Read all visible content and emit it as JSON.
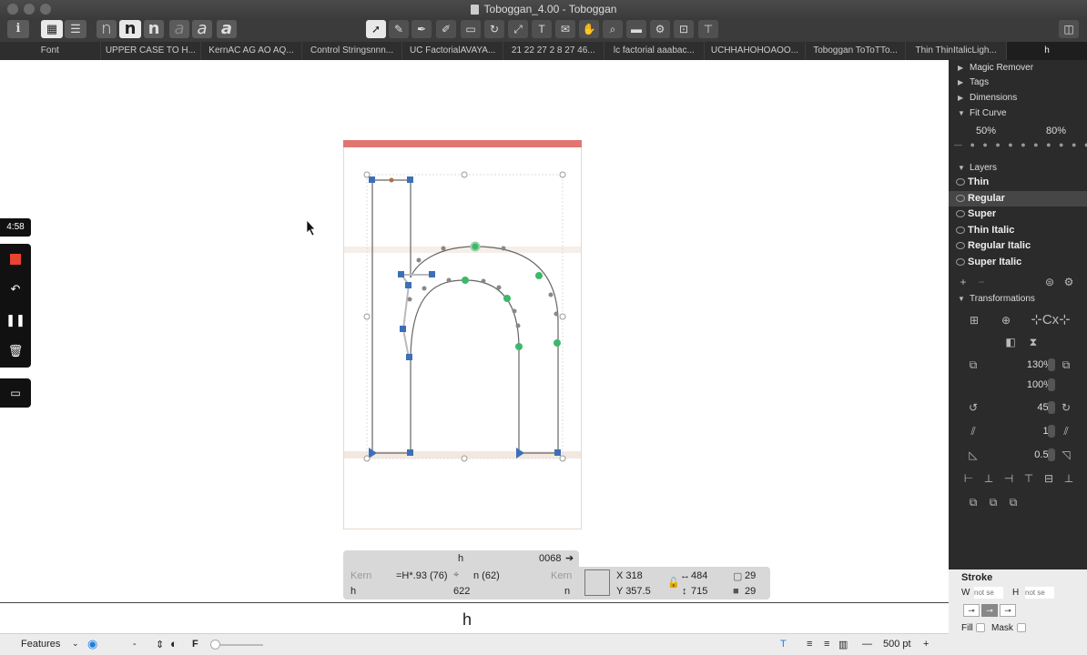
{
  "window": {
    "title": "Toboggan_4.00 - Toboggan"
  },
  "toolbar": {
    "info_label": "i",
    "glyph_buttons": [
      "n",
      "n",
      "n",
      "a",
      "a",
      "a"
    ],
    "tools": [
      "select-tool-icon",
      "pencil-icon",
      "pen-icon",
      "brush-icon",
      "rectangle-icon",
      "rotate-icon",
      "scale-icon",
      "text-icon",
      "annotation-icon",
      "hand-icon",
      "zoom-icon",
      "measure-icon",
      "component-icon",
      "kerning-icon"
    ]
  },
  "tabs": [
    "Font",
    "UPPER CASE TO H...",
    "KernAC AG AO AQ...",
    "Control Stringsnnn...",
    "UC FactorialAVAYA...",
    "21 22 27 2 8 27 46...",
    "lc factorial aaabac...",
    "UCHHAHOHOAOO...",
    "Toboggan ToToTTo...",
    "Thin ThinItalicLigh...",
    "h"
  ],
  "recorder": {
    "time": "4:58"
  },
  "info": {
    "glyph_name": "h",
    "unicode": "0068",
    "kern_left_label": "Kern",
    "kern_right_label": "Kern",
    "left_metric": "=H*.93 (76)",
    "right_metric": "n (62)",
    "left_glyph": "h",
    "width": "622",
    "right_glyph": "n",
    "x": "X 318",
    "y": "Y 357.5",
    "w": "484",
    "h": "715",
    "count1": "29",
    "count2": "29"
  },
  "preview": {
    "glyph": "h"
  },
  "statusbar": {
    "features": "Features",
    "dash": "-",
    "size": "500 pt",
    "minus": "—",
    "plus": "+"
  },
  "rpanel": {
    "magic_remover": "Magic Remover",
    "tags": "Tags",
    "dimensions": "Dimensions",
    "fit_curve": "Fit Curve",
    "fit_min": "50%",
    "fit_max": "80%",
    "layers_title": "Layers",
    "layers": [
      "Thin",
      "Regular",
      "Super",
      "Thin Italic",
      "Regular Italic",
      "Super Italic"
    ],
    "transformations": "Transformations",
    "scale_x": "130%",
    "scale_y": "100%",
    "rotate": "45°",
    "slant1": "1°",
    "slant2": "0.5°"
  },
  "stroke": {
    "title": "Stroke",
    "w_label": "W",
    "w_placeholder": "not se",
    "h_label": "H",
    "h_placeholder": "not se",
    "fill_label": "Fill",
    "mask_label": "Mask"
  },
  "colors": {
    "accent_blue": "#3d6fb8",
    "node_green": "#3db86a",
    "metric_red": "#e07670"
  }
}
